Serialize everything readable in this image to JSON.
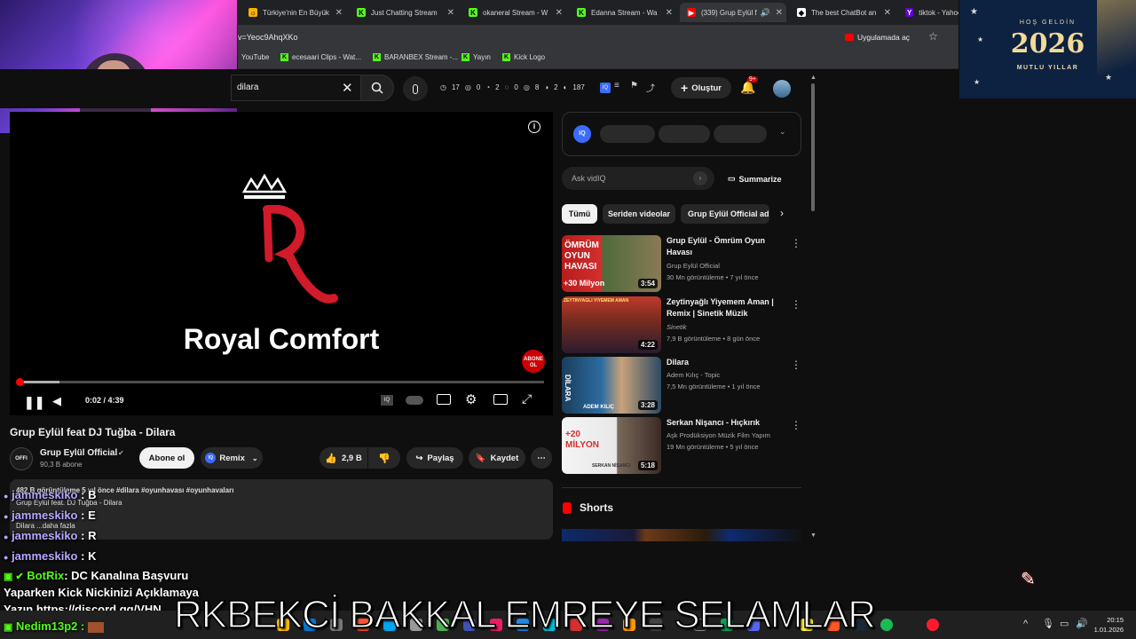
{
  "tabs": [
    {
      "label": "Türkiye'nin En Büyük",
      "icon": "globe-icon",
      "color": "#f5b400"
    },
    {
      "label": "Just Chatting Stream",
      "icon": "kick-icon",
      "color": "#53fc18"
    },
    {
      "label": "okaneral Stream - W",
      "icon": "kick-icon",
      "color": "#53fc18"
    },
    {
      "label": "Edanna Stream - Wa",
      "icon": "kick-icon",
      "color": "#53fc18"
    },
    {
      "label": "(339) Grup Eylül f",
      "icon": "youtube-icon",
      "color": "#ff0000"
    },
    {
      "label": "The best ChatBot an",
      "icon": "chatbot-icon",
      "color": "#ffffff"
    },
    {
      "label": "tiktok - Yahoo",
      "icon": "yahoo-icon",
      "color": "#6001d2"
    }
  ],
  "url": {
    "text": "v=Yeoc9AhqXKo",
    "open_in_app": "Uygulamada aç"
  },
  "bookmarks": [
    "YouTube",
    "ecesaari Clips - Wat...",
    "BARANBEX Stream -...",
    "Yayın",
    "Kick Logo"
  ],
  "header": {
    "search_value": "dilara",
    "stats": {
      "a": "17",
      "b": "0",
      "c": "2",
      "d": "0",
      "e": "8",
      "f": "2",
      "g": "187"
    },
    "create_label": "Oluştur",
    "notif_badge": "9+"
  },
  "player": {
    "brand_text": "Royal Comfort",
    "time": "0:02 / 4:39",
    "subscribe_badge": "ABONE OL",
    "progress_fraction": 0.007
  },
  "video": {
    "title": "Grup Eylül feat DJ Tuğba - Dilara",
    "channel": "Grup Eylül Official",
    "subscribers": "90,3 B abone",
    "subscribe_label": "Abone ol",
    "remix_label": "Remix",
    "likes": "2,9 B",
    "share_label": "Paylaş",
    "save_label": "Kaydet",
    "desc_meta": "482 B görüntüleme  5 yıl önce  #dilara #oyunhavası #oyunhavaları",
    "desc_line1": "Grup Eylül feat. DJ Tuğba - Dilara",
    "desc_line2": "Dilara ...daha fazla"
  },
  "sidebar": {
    "ask_placeholder": "Ask vidIQ",
    "summarize_label": "Summarize",
    "chips": [
      "Tümü",
      "Seriden videolar",
      "Grup Eylül Official ad"
    ],
    "recs": [
      {
        "title": "Grup Eylül - Ömrüm Oyun Havası",
        "channel": "Grup Eylül Official",
        "meta": "30 Mn görüntüleme • 7 yıl önce",
        "duration": "3:54",
        "thumb_text": "ÖMRÜM OYUN HAVASI",
        "thumb_sub": "+30 Milyon"
      },
      {
        "title": "Zeytinyağlı Yiyemem Aman | Remix | Sinetik Müzik",
        "channel": "Sinetik",
        "meta": "7,9 B görüntüleme • 8 gün önce",
        "duration": "4:22",
        "thumb_text": "ZEYTINYAĞLI YİYEMEM AMAN",
        "thumb_sub": ""
      },
      {
        "title": "Dilara",
        "channel": "Adem Kılıç - Topic",
        "meta": "7,5 Mn görüntüleme • 1 yıl önce",
        "duration": "3:28",
        "thumb_text": "DİLARA",
        "thumb_sub": "ADEM KILIÇ"
      },
      {
        "title": "Serkan Nişancı - Hıçkırık",
        "channel": "Aşk Prodüksiyon Müzik Film Yapım",
        "meta": "19 Mn görüntüleme • 5 yıl önce",
        "duration": "5:18",
        "thumb_text": "+20 MİLYON",
        "thumb_sub": "SERKAN NİŞANCI"
      }
    ],
    "shorts_label": "Shorts"
  },
  "chat": [
    {
      "user": "jammeskiko",
      "msg": "B"
    },
    {
      "user": "jammeskiko",
      "msg": "E"
    },
    {
      "user": "jammeskiko",
      "msg": "R"
    },
    {
      "user": "jammeskiko",
      "msg": "K"
    }
  ],
  "bot": {
    "user": "BotRix",
    "line1": ": DC Kanalına Başvuru",
    "line2": "Yaparken Kick Nickinizi Açıklamaya",
    "line3": "Yazın https://discord.gg/VHN..."
  },
  "last_user": "Nedim13p2 :",
  "ticker": "RKBEKCİ BAKKAL EMREYE SELAMLAR",
  "banner": {
    "welcome": "HOŞ GELDİN",
    "year": "2026",
    "wish": "MUTLU YILLAR"
  },
  "clock": {
    "time": "20:15",
    "date": "1.01.2026"
  }
}
